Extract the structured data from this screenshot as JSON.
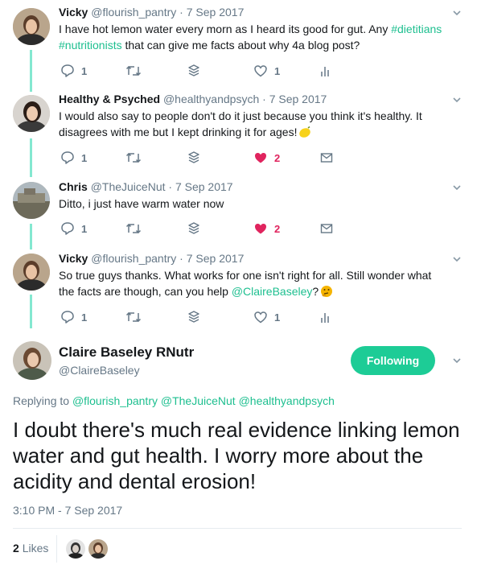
{
  "tweets": [
    {
      "name": "Vicky",
      "handle": "@flourish_pantry",
      "sep": "·",
      "date": "7 Sep 2017",
      "text_a": "I have hot lemon water every morn as I heard its good for gut. Any ",
      "tag_1": "#dietitians",
      "tag_2": "#nutritionists",
      "text_b": " that can give me facts about why 4a blog post?",
      "replies": "1",
      "likes": "1"
    },
    {
      "name": "Healthy & Psyched",
      "handle": "@healthyandpsych",
      "sep": "·",
      "date": "7 Sep 2017",
      "text": "I would also say to people don't do it just because you think it's healthy. It disagrees with me but I kept drinking it for ages!",
      "emoji": "lemon-emoji",
      "replies": "1",
      "likes": "2"
    },
    {
      "name": "Chris",
      "handle": "@TheJuiceNut",
      "sep": "·",
      "date": "7 Sep 2017",
      "text": "Ditto, i just have warm water now",
      "replies": "1",
      "likes": "2"
    },
    {
      "name": "Vicky",
      "handle": "@flourish_pantry",
      "sep": "·",
      "date": "7 Sep 2017",
      "text_a": "So true guys thanks. What works for one isn't right for all. Still wonder what the facts are though, can you help ",
      "mention": "@ClaireBaseley",
      "text_b": "?",
      "emoji": "thinking-face-emoji",
      "replies": "1",
      "likes": "1"
    }
  ],
  "main": {
    "name": "Claire Baseley RNutr",
    "handle": "@ClaireBaseley",
    "follow_label": "Following",
    "replying_prefix": "Replying to",
    "replying_to": [
      "@flourish_pantry",
      "@TheJuiceNut",
      "@healthyandpsych"
    ],
    "text": "I doubt there's much real evidence linking lemon water and gut health. I worry more about the acidity and dental erosion!",
    "timestamp": "3:10 PM - 7 Sep 2017",
    "likes_count": "2",
    "likes_label": "Likes"
  },
  "colors": {
    "accent": "#1dcc96",
    "link": "#1dbf8f",
    "thread_line": "#84e8d0",
    "liked_red": "#e0245e",
    "muted": "#657786"
  }
}
